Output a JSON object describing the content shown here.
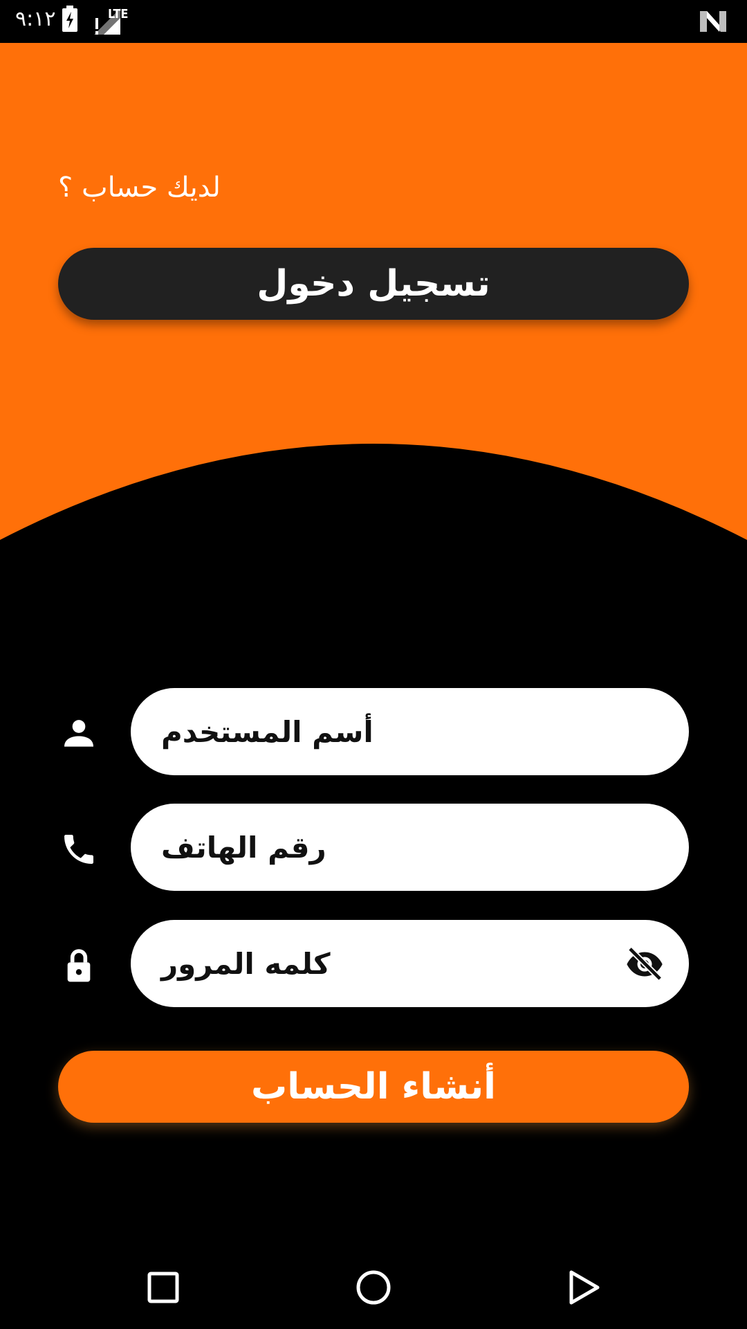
{
  "status_bar": {
    "time": "٩:١٢",
    "icons": [
      "battery-charging-icon",
      "signal-no-data-icon",
      "lte-icon",
      "n-logo-icon"
    ],
    "lte_label": "LTE"
  },
  "header": {
    "have_account_text": "لديك حساب ؟",
    "login_button_label": "تسجيل دخول"
  },
  "form": {
    "username": {
      "placeholder": "أسم المستخدم",
      "icon": "person-icon"
    },
    "phone": {
      "placeholder": "رقم الهاتف",
      "icon": "phone-icon"
    },
    "password": {
      "placeholder": "كلمه المرور",
      "icon": "lock-icon",
      "toggle_icon": "eye-off-icon"
    },
    "create_button_label": "أنشاء الحساب"
  },
  "nav_bar": {
    "items": [
      "recents-square-icon",
      "home-circle-icon",
      "back-triangle-icon"
    ]
  },
  "colors": {
    "accent": "#ff7009",
    "dark_button": "#212121",
    "background": "#000000",
    "field": "#ffffff"
  }
}
